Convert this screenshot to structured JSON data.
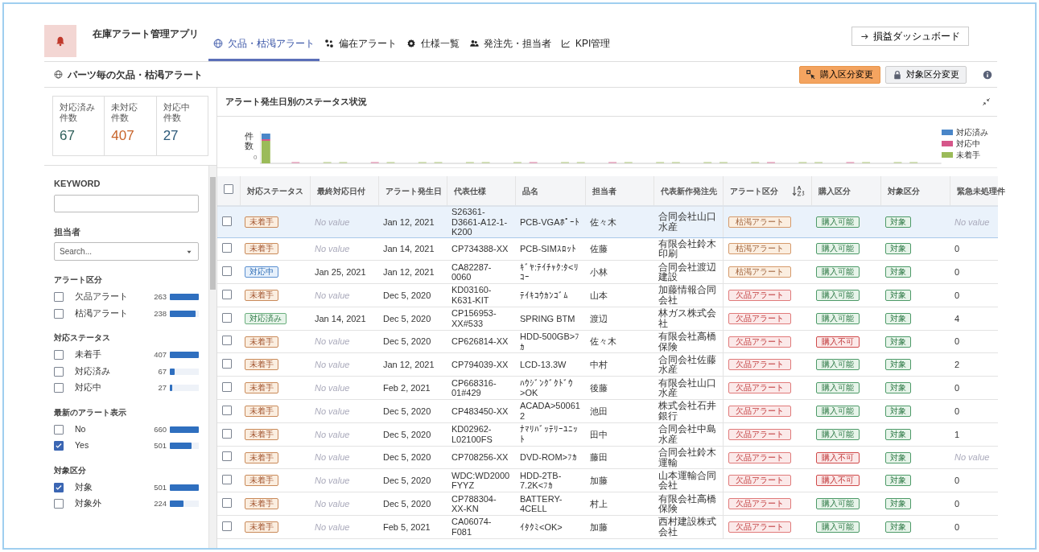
{
  "app": {
    "title": "在庫アラート管理アプリ"
  },
  "tabs": [
    {
      "label": "欠品・枯渇アラート",
      "kind": "globe",
      "selected": true
    },
    {
      "label": "偏在アラート",
      "kind": "scatter",
      "selected": false
    },
    {
      "label": "仕様一覧",
      "kind": "gear",
      "selected": false
    },
    {
      "label": "発注先・担当者",
      "kind": "people",
      "selected": false
    },
    {
      "label": "KPI管理",
      "kind": "chart",
      "selected": false
    }
  ],
  "dashboard_button": "損益ダッシュボード",
  "page_title": "パーツ毎の欠品・枯渇アラート",
  "actions": [
    {
      "label": "購入区分変更",
      "kind": "primary"
    },
    {
      "label": "対象区分変更",
      "kind": "secondary"
    }
  ],
  "stats": [
    {
      "label": [
        "対応済み",
        "件数"
      ],
      "value": "67",
      "color": "#2f5f5a"
    },
    {
      "label": [
        "未対応",
        "件数"
      ],
      "value": "407",
      "color": "#c8642a"
    },
    {
      "label": [
        "対応中",
        "件数"
      ],
      "value": "27",
      "color": "#2d5a7a"
    }
  ],
  "keyword": {
    "label": "KEYWORD"
  },
  "assignee": {
    "label": "担当者",
    "placeholder": "Search..."
  },
  "filters": [
    {
      "title": "アラート区分",
      "items": [
        {
          "label": "欠品アラート",
          "count": "263",
          "level": 1.0,
          "checked": false
        },
        {
          "label": "枯渇アラート",
          "count": "238",
          "level": 0.9,
          "checked": false
        }
      ]
    },
    {
      "title": "対応ステータス",
      "items": [
        {
          "label": "未着手",
          "count": "407",
          "level": 1.0,
          "checked": false
        },
        {
          "label": "対応済み",
          "count": "67",
          "level": 0.17,
          "checked": false
        },
        {
          "label": "対応中",
          "count": "27",
          "level": 0.07,
          "checked": false
        }
      ]
    },
    {
      "title": "最新のアラート表示",
      "items": [
        {
          "label": "No",
          "count": "660",
          "level": 1.0,
          "checked": false
        },
        {
          "label": "Yes",
          "count": "501",
          "level": 0.76,
          "checked": true
        }
      ]
    },
    {
      "title": "対象区分",
      "items": [
        {
          "label": "対象",
          "count": "501",
          "level": 1.0,
          "checked": true
        },
        {
          "label": "対象外",
          "count": "224",
          "level": 0.46,
          "checked": false
        }
      ]
    }
  ],
  "chart": {
    "title": "アラート発生日別のステータス状況",
    "ylabel": "件数",
    "ytick": "0",
    "legend": [
      {
        "label": "対応済み",
        "color": "#4a86c8"
      },
      {
        "label": "対応中",
        "color": "#d6578a"
      },
      {
        "label": "未着手",
        "color": "#9bbb59"
      }
    ]
  },
  "table": {
    "all_checked": false,
    "columns": [
      "対応ステータス",
      "最終対応日付",
      "アラート発生日",
      "代表仕様",
      "品名",
      "担当者",
      "代表新作発注先",
      "アラート区分",
      "購入区分",
      "対象区分",
      "緊急未処理件"
    ],
    "rows": [
      {
        "selected": true,
        "checked": false,
        "status": {
          "text": "未着手",
          "kind": "pending"
        },
        "last_date": "No value",
        "last_date_empty": true,
        "alert_date": "Jan 12, 2021",
        "spec": "S26361-D3661-A12-1-K200",
        "item": "PCB-VGAﾎﾟｰﾄ",
        "person": "佐々木",
        "supplier": "合同会社山口水産",
        "alert": {
          "text": "枯渇アラート",
          "kind": "depletion"
        },
        "purchase": "購入可能",
        "purchase_ok": true,
        "target": "対象",
        "urgent": "No value",
        "urgent_empty": true
      },
      {
        "selected": false,
        "checked": false,
        "status": {
          "text": "未着手",
          "kind": "pending"
        },
        "last_date": "No value",
        "last_date_empty": true,
        "alert_date": "Jan 14, 2021",
        "spec": "CP734388-XX",
        "item": "PCB-SIMｽﾛｯﾄ",
        "person": "佐藤",
        "supplier": "有限会社鈴木印刷",
        "alert": {
          "text": "枯渇アラート",
          "kind": "depletion"
        },
        "purchase": "購入可能",
        "purchase_ok": true,
        "target": "対象",
        "urgent": "0",
        "urgent_empty": false
      },
      {
        "selected": false,
        "checked": false,
        "status": {
          "text": "対応中",
          "kind": "in_progress"
        },
        "last_date": "Jan 25, 2021",
        "last_date_empty": false,
        "alert_date": "Jan 12, 2021",
        "spec": "CA82287-0060",
        "item": "ｷﾞﾔ:ﾃｲﾁｬｸ:ﾀ<ﾘｺｰ",
        "person": "小林",
        "supplier": "合同会社渡辺建設",
        "alert": {
          "text": "枯渇アラート",
          "kind": "depletion"
        },
        "purchase": "購入可能",
        "purchase_ok": true,
        "target": "対象",
        "urgent": "0",
        "urgent_empty": false
      },
      {
        "selected": false,
        "checked": false,
        "status": {
          "text": "未着手",
          "kind": "pending"
        },
        "last_date": "No value",
        "last_date_empty": true,
        "alert_date": "Dec 5, 2020",
        "spec": "KD03160-K631-KIT",
        "item": "ﾃｲｷｺｳｶﾝｺﾞﾑ",
        "person": "山本",
        "supplier": "加藤情報合同会社",
        "alert": {
          "text": "欠品アラート",
          "kind": "shortage"
        },
        "purchase": "購入可能",
        "purchase_ok": true,
        "target": "対象",
        "urgent": "0",
        "urgent_empty": false
      },
      {
        "selected": false,
        "checked": false,
        "status": {
          "text": "対応済み",
          "kind": "done"
        },
        "last_date": "Jan 14, 2021",
        "last_date_empty": false,
        "alert_date": "Dec 5, 2020",
        "spec": "CP156953-XX#533",
        "item": "SPRING BTM",
        "person": "渡辺",
        "supplier": "林ガス株式会社",
        "alert": {
          "text": "欠品アラート",
          "kind": "shortage"
        },
        "purchase": "購入可能",
        "purchase_ok": true,
        "target": "対象",
        "urgent": "4",
        "urgent_empty": false
      },
      {
        "selected": false,
        "checked": false,
        "status": {
          "text": "未着手",
          "kind": "pending"
        },
        "last_date": "No value",
        "last_date_empty": true,
        "alert_date": "Dec 5, 2020",
        "spec": "CP626814-XX",
        "item": "HDD-500GB>ﾌｶ",
        "person": "佐々木",
        "supplier": "有限会社高橋保険",
        "alert": {
          "text": "欠品アラート",
          "kind": "shortage"
        },
        "purchase": "購入不可",
        "purchase_ok": false,
        "target": "対象",
        "urgent": "0",
        "urgent_empty": false
      },
      {
        "selected": false,
        "checked": false,
        "status": {
          "text": "未着手",
          "kind": "pending"
        },
        "last_date": "No value",
        "last_date_empty": true,
        "alert_date": "Jan 12, 2021",
        "spec": "CP794039-XX",
        "item": "LCD-13.3W",
        "person": "中村",
        "supplier": "合同会社佐藤水産",
        "alert": {
          "text": "欠品アラート",
          "kind": "shortage"
        },
        "purchase": "購入可能",
        "purchase_ok": true,
        "target": "対象",
        "urgent": "2",
        "urgent_empty": false
      },
      {
        "selected": false,
        "checked": false,
        "status": {
          "text": "未着手",
          "kind": "pending"
        },
        "last_date": "No value",
        "last_date_empty": true,
        "alert_date": "Feb 2, 2021",
        "spec": "CP668316-01#429",
        "item": "ﾊｳｼﾞﾝｸﾞｸﾄﾞｳ>OK",
        "person": "後藤",
        "supplier": "有限会社山口水産",
        "alert": {
          "text": "欠品アラート",
          "kind": "shortage"
        },
        "purchase": "購入可能",
        "purchase_ok": true,
        "target": "対象",
        "urgent": "0",
        "urgent_empty": false
      },
      {
        "selected": false,
        "checked": false,
        "status": {
          "text": "未着手",
          "kind": "pending"
        },
        "last_date": "No value",
        "last_date_empty": true,
        "alert_date": "Dec 5, 2020",
        "spec": "CP483450-XX",
        "item": "ACADA>500612",
        "person": "池田",
        "supplier": "株式会社石井銀行",
        "alert": {
          "text": "欠品アラート",
          "kind": "shortage"
        },
        "purchase": "購入可能",
        "purchase_ok": true,
        "target": "対象",
        "urgent": "0",
        "urgent_empty": false
      },
      {
        "selected": false,
        "checked": false,
        "status": {
          "text": "未着手",
          "kind": "pending"
        },
        "last_date": "No value",
        "last_date_empty": true,
        "alert_date": "Dec 5, 2020",
        "spec": "KD02962-L02100FS",
        "item": "ﾅﾏﾘﾊﾞｯﾃﾘｰﾕﾆｯﾄ",
        "person": "田中",
        "supplier": "合同会社中島水産",
        "alert": {
          "text": "欠品アラート",
          "kind": "shortage"
        },
        "purchase": "購入可能",
        "purchase_ok": true,
        "target": "対象",
        "urgent": "1",
        "urgent_empty": false
      },
      {
        "selected": false,
        "checked": false,
        "status": {
          "text": "未着手",
          "kind": "pending"
        },
        "last_date": "No value",
        "last_date_empty": true,
        "alert_date": "Dec 5, 2020",
        "spec": "CP708256-XX",
        "item": "DVD-ROM>ﾌｶ",
        "person": "藤田",
        "supplier": "合同会社鈴木運輸",
        "alert": {
          "text": "欠品アラート",
          "kind": "shortage"
        },
        "purchase": "購入不可",
        "purchase_ok": false,
        "target": "対象",
        "urgent": "No value",
        "urgent_empty": true
      },
      {
        "selected": false,
        "checked": false,
        "status": {
          "text": "未着手",
          "kind": "pending"
        },
        "last_date": "No value",
        "last_date_empty": true,
        "alert_date": "Dec 5, 2020",
        "spec": "WDC:WD2000FYYZ",
        "item": "HDD-2TB-7.2K<ﾌｶ",
        "person": "加藤",
        "supplier": "山本運輸合同会社",
        "alert": {
          "text": "欠品アラート",
          "kind": "shortage"
        },
        "purchase": "購入不可",
        "purchase_ok": false,
        "target": "対象",
        "urgent": "0",
        "urgent_empty": false
      },
      {
        "selected": false,
        "checked": false,
        "status": {
          "text": "未着手",
          "kind": "pending"
        },
        "last_date": "No value",
        "last_date_empty": true,
        "alert_date": "Dec 5, 2020",
        "spec": "CP788304-XX-KN",
        "item": "BATTERY-4CELL",
        "person": "村上",
        "supplier": "有限会社高橋保険",
        "alert": {
          "text": "欠品アラート",
          "kind": "shortage"
        },
        "purchase": "購入可能",
        "purchase_ok": true,
        "target": "対象",
        "urgent": "0",
        "urgent_empty": false
      },
      {
        "selected": false,
        "checked": false,
        "status": {
          "text": "未着手",
          "kind": "pending"
        },
        "last_date": "No value",
        "last_date_empty": true,
        "alert_date": "Feb 5, 2021",
        "spec": "CA06074-F081",
        "item": "ｲﾀｸﾐ<OK>",
        "person": "加藤",
        "supplier": "西村建設株式会社",
        "alert": {
          "text": "欠品アラート",
          "kind": "shortage"
        },
        "purchase": "購入可能",
        "purchase_ok": true,
        "target": "対象",
        "urgent": "0",
        "urgent_empty": false
      }
    ]
  }
}
